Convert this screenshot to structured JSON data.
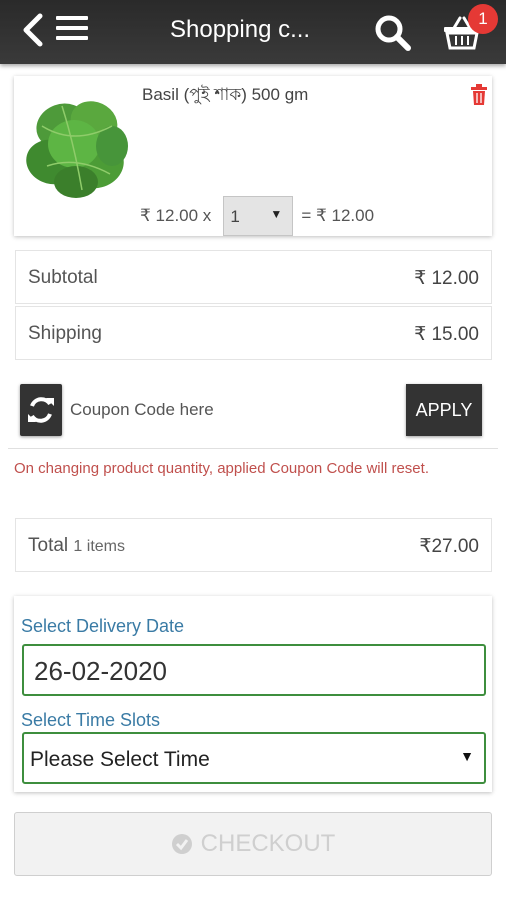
{
  "header": {
    "title": "Shopping c...",
    "cart_count": "1"
  },
  "product": {
    "name": "Basil (পুই শাক) 500 gm",
    "unit_price": "₹ 12.00 x",
    "quantity": "1",
    "line_total": "= ₹ 12.00"
  },
  "summary": {
    "subtotal_label": "Subtotal",
    "subtotal_value": "₹ 12.00",
    "shipping_label": "Shipping",
    "shipping_value": "₹ 15.00"
  },
  "coupon": {
    "placeholder": "Coupon Code here",
    "apply_label": "APPLY",
    "warning": "On changing product quantity, applied Coupon Code will reset."
  },
  "total": {
    "label": "Total",
    "items": "1 items",
    "value": "₹27.00"
  },
  "delivery": {
    "date_label": "Select Delivery Date",
    "date_value": "26-02-2020",
    "time_label": "Select Time Slots",
    "time_value": "Please Select Time"
  },
  "checkout": {
    "label": "CHECKOUT"
  },
  "icons": [
    "back-arrow-icon",
    "menu-icon",
    "search-icon",
    "cart-basket-icon",
    "trash-icon",
    "refresh-icon",
    "check-circle-icon"
  ],
  "colors": {
    "topbar": "#333333",
    "badge": "#e53935",
    "accent_label": "#3a7ba5",
    "field_border": "#3e8e3e",
    "warning": "#c0504d",
    "trash": "#e53935"
  }
}
